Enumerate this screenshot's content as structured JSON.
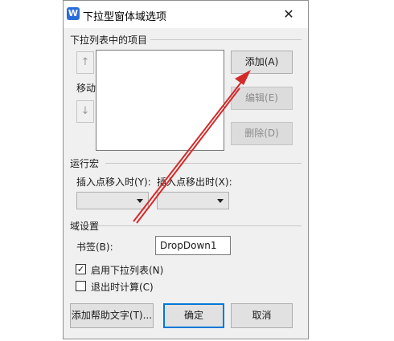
{
  "window": {
    "title": "下拉型窗体域选项",
    "app_icon_letter": "W",
    "close_symbol": "✕"
  },
  "list_section": {
    "title": "下拉列表中的项目",
    "move_label": "移动",
    "up_arrow": "↑",
    "down_arrow": "↓",
    "add_button": "添加(A)",
    "edit_button": "编辑(E)",
    "delete_button": "删除(D)"
  },
  "macro_section": {
    "title": "运行宏",
    "entry_label": "插入点移入时(Y):",
    "exit_label": "插入点移出时(X):",
    "entry_value": "",
    "exit_value": ""
  },
  "field_section": {
    "title": "域设置",
    "bookmark_label": "书签(B):",
    "bookmark_value": "DropDown1",
    "enable_dropdown_label": "启用下拉列表(N)",
    "enable_dropdown_checked": true,
    "calc_on_exit_label": "退出时计算(C)",
    "calc_on_exit_checked": false,
    "check_mark": "✓"
  },
  "footer": {
    "help_text_button": "添加帮助文字(T)...",
    "ok_button": "确定",
    "cancel_button": "取消"
  },
  "annotation": {
    "arrow_color": "#d42a2a"
  }
}
